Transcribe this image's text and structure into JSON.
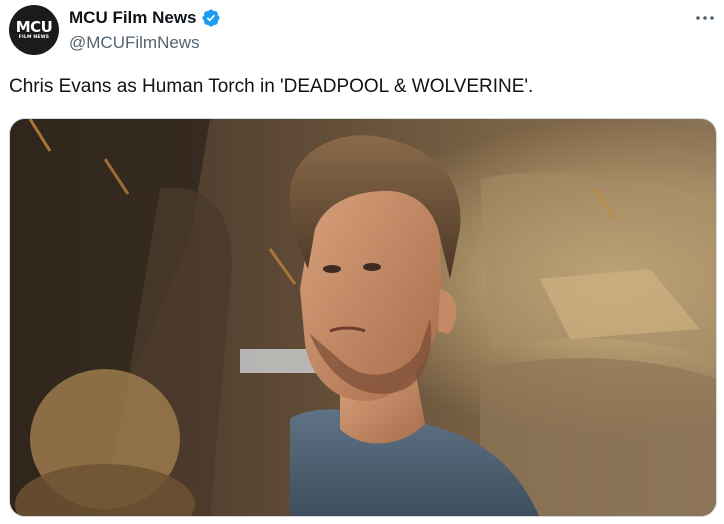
{
  "post": {
    "author": {
      "avatar_text": "MCU",
      "avatar_subtext": "FILM NEWS",
      "display_name": "MCU Film News",
      "handle": "@MCUFilmNews",
      "verified": true,
      "verified_color": "#1d9bf0"
    },
    "text": "Chris Evans as Human Torch in 'DEADPOOL & WOLVERINE'.",
    "media": {
      "type": "photo"
    },
    "more_icon": "more-options-icon"
  },
  "colors": {
    "text_primary": "#0f1419",
    "text_secondary": "#536471",
    "border": "#cfd9de"
  }
}
